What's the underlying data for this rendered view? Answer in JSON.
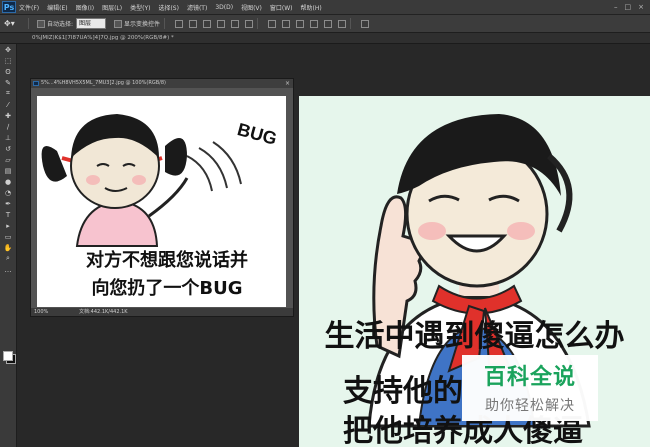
{
  "app": {
    "logo": "Ps",
    "menu": [
      "文件(F)",
      "编辑(E)",
      "图像(I)",
      "图层(L)",
      "类型(Y)",
      "选择(S)",
      "滤镜(T)",
      "3D(D)",
      "视图(V)",
      "窗口(W)",
      "帮助(H)"
    ],
    "window_controls": [
      "–",
      "□",
      "×"
    ]
  },
  "options_bar": {
    "auto_select_label": "自动选择:",
    "auto_select_value": "图层",
    "show_transform_label": "显示变换控件"
  },
  "tabs": {
    "active_tab": "0%JMIZ)K$1[7I87UA%]4]7Q.jpg @ 200%(RGB/8#) *"
  },
  "float_window": {
    "title": "5%...4%H8VH5X5ML_7MU3]2.jpg @ 100%(RGB/8)",
    "zoom": "100%",
    "doc_info": "文档:442.1K/442.1K"
  },
  "meme_left": {
    "bug": "BUG",
    "line1": "对方不想跟您说话并",
    "line2": "向您扔了一个BUG"
  },
  "meme_right": {
    "line1": "生活中遇到傻逼怎么办",
    "line2": "支持他的",
    "line3": "把他培养成人傻逼"
  },
  "watermark": {
    "title": "百科全说",
    "subtitle": "助你轻松解决"
  },
  "colors": {
    "ps_blue": "#4fb3ff",
    "watermark_green": "#1aa35c",
    "scarf_red": "#e0312b",
    "canvas_mint": "#e6f6ec"
  }
}
